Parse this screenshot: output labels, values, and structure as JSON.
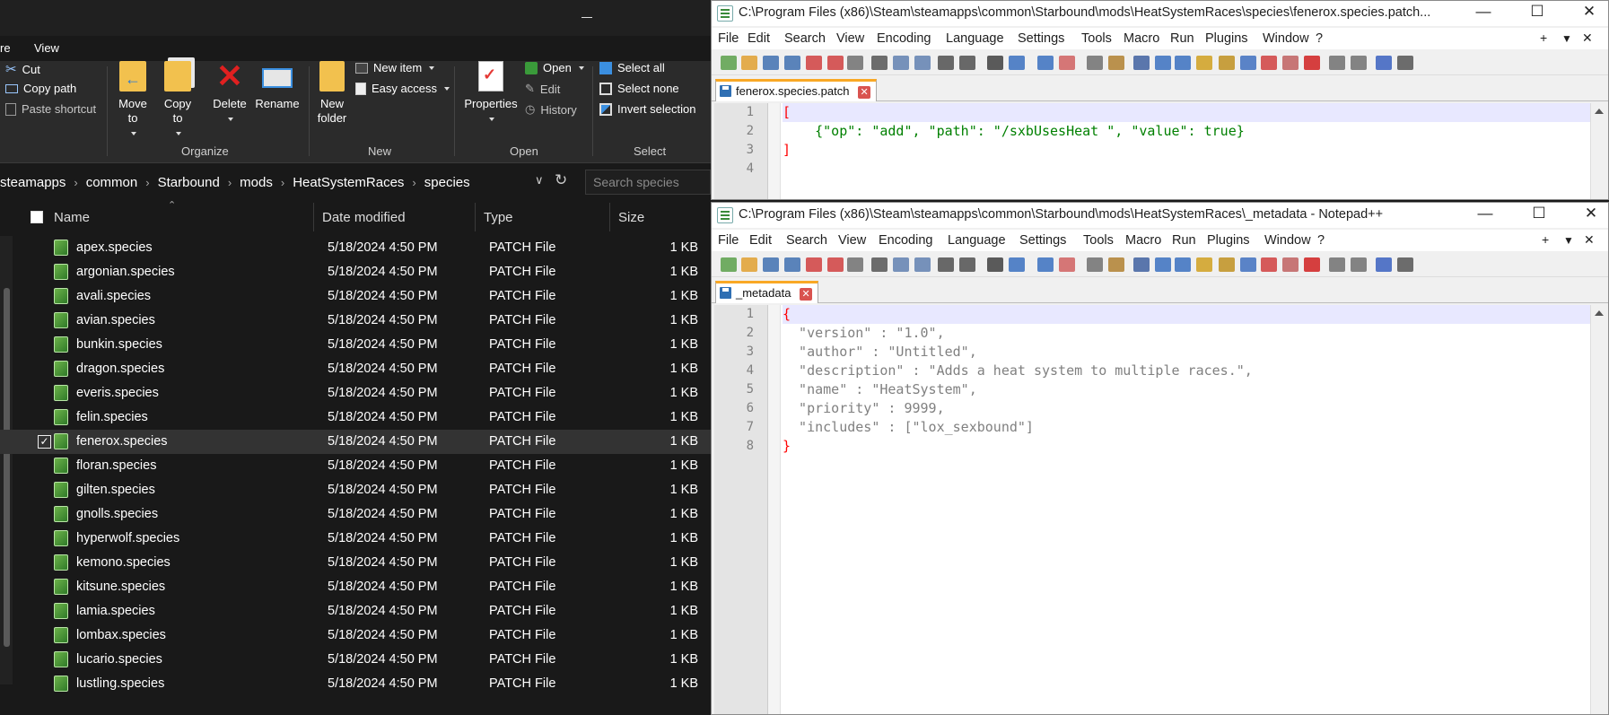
{
  "explorer": {
    "menu_tabs": [
      "re",
      "View"
    ],
    "ribbon": {
      "clipboard": {
        "cut": "Cut",
        "copy_path": "Copy path",
        "paste_shortcut": "Paste shortcut"
      },
      "organize": {
        "move_to": "Move to",
        "copy_to": "Copy to",
        "delete": "Delete",
        "rename": "Rename",
        "label": "Organize"
      },
      "new": {
        "new_folder": "New folder",
        "new_item": "New item",
        "easy_access": "Easy access",
        "label": "New"
      },
      "open": {
        "properties": "Properties",
        "open": "Open",
        "edit": "Edit",
        "history": "History",
        "label": "Open"
      },
      "select": {
        "select_all": "Select all",
        "select_none": "Select none",
        "invert_selection": "Invert selection",
        "label": "Select"
      }
    },
    "address": [
      "steamapps",
      "common",
      "Starbound",
      "mods",
      "HeatSystemRaces",
      "species"
    ],
    "search_placeholder": "Search species",
    "columns": {
      "name": "Name",
      "date": "Date modified",
      "type": "Type",
      "size": "Size"
    },
    "files": [
      {
        "name": "apex.species",
        "date": "5/18/2024 4:50 PM",
        "type": "PATCH File",
        "size": "1 KB"
      },
      {
        "name": "argonian.species",
        "date": "5/18/2024 4:50 PM",
        "type": "PATCH File",
        "size": "1 KB"
      },
      {
        "name": "avali.species",
        "date": "5/18/2024 4:50 PM",
        "type": "PATCH File",
        "size": "1 KB"
      },
      {
        "name": "avian.species",
        "date": "5/18/2024 4:50 PM",
        "type": "PATCH File",
        "size": "1 KB"
      },
      {
        "name": "bunkin.species",
        "date": "5/18/2024 4:50 PM",
        "type": "PATCH File",
        "size": "1 KB"
      },
      {
        "name": "dragon.species",
        "date": "5/18/2024 4:50 PM",
        "type": "PATCH File",
        "size": "1 KB"
      },
      {
        "name": "everis.species",
        "date": "5/18/2024 4:50 PM",
        "type": "PATCH File",
        "size": "1 KB"
      },
      {
        "name": "felin.species",
        "date": "5/18/2024 4:50 PM",
        "type": "PATCH File",
        "size": "1 KB"
      },
      {
        "name": "fenerox.species",
        "date": "5/18/2024 4:50 PM",
        "type": "PATCH File",
        "size": "1 KB",
        "selected": true
      },
      {
        "name": "floran.species",
        "date": "5/18/2024 4:50 PM",
        "type": "PATCH File",
        "size": "1 KB"
      },
      {
        "name": "gilten.species",
        "date": "5/18/2024 4:50 PM",
        "type": "PATCH File",
        "size": "1 KB"
      },
      {
        "name": "gnolls.species",
        "date": "5/18/2024 4:50 PM",
        "type": "PATCH File",
        "size": "1 KB"
      },
      {
        "name": "hyperwolf.species",
        "date": "5/18/2024 4:50 PM",
        "type": "PATCH File",
        "size": "1 KB"
      },
      {
        "name": "kemono.species",
        "date": "5/18/2024 4:50 PM",
        "type": "PATCH File",
        "size": "1 KB"
      },
      {
        "name": "kitsune.species",
        "date": "5/18/2024 4:50 PM",
        "type": "PATCH File",
        "size": "1 KB"
      },
      {
        "name": "lamia.species",
        "date": "5/18/2024 4:50 PM",
        "type": "PATCH File",
        "size": "1 KB"
      },
      {
        "name": "lombax.species",
        "date": "5/18/2024 4:50 PM",
        "type": "PATCH File",
        "size": "1 KB"
      },
      {
        "name": "lucario.species",
        "date": "5/18/2024 4:50 PM",
        "type": "PATCH File",
        "size": "1 KB"
      },
      {
        "name": "lustling.species",
        "date": "5/18/2024 4:50 PM",
        "type": "PATCH File",
        "size": "1 KB"
      }
    ]
  },
  "npp_menu": [
    "File",
    "Edit",
    "Search",
    "View",
    "Encoding",
    "Language",
    "Settings",
    "Tools",
    "Macro",
    "Run",
    "Plugins",
    "Window",
    "?"
  ],
  "npp1": {
    "title": "C:\\Program Files (x86)\\Steam\\steamapps\\common\\Starbound\\mods\\HeatSystemRaces\\species\\fenerox.species.patch...",
    "tab": "fenerox.species.patch",
    "lines": [
      "1",
      "2",
      "3",
      "4"
    ],
    "code": {
      "l1": "[",
      "l2": "    {\"op\": \"add\", \"path\": \"/sxbUsesHeat \", \"value\": true}",
      "l3": "]"
    }
  },
  "npp2": {
    "title": "C:\\Program Files (x86)\\Steam\\steamapps\\common\\Starbound\\mods\\HeatSystemRaces\\_metadata - Notepad++",
    "tab": "_metadata",
    "lines": [
      "1",
      "2",
      "3",
      "4",
      "5",
      "6",
      "7",
      "8"
    ],
    "code": [
      "{",
      "  \"version\" : \"1.0\",",
      "  \"author\" : \"Untitled\",",
      "  \"description\" : \"Adds a heat system to multiple races.\",",
      "  \"name\" : \"HeatSystem\",",
      "  \"priority\" : 9999,",
      "  \"includes\" : [\"lox_sexbound\"]",
      "}"
    ]
  },
  "window_controls": {
    "minimize": "—",
    "maximize": "☐",
    "close": "✕",
    "add": "+",
    "dropdown": "▼",
    "close_small": "✕"
  }
}
